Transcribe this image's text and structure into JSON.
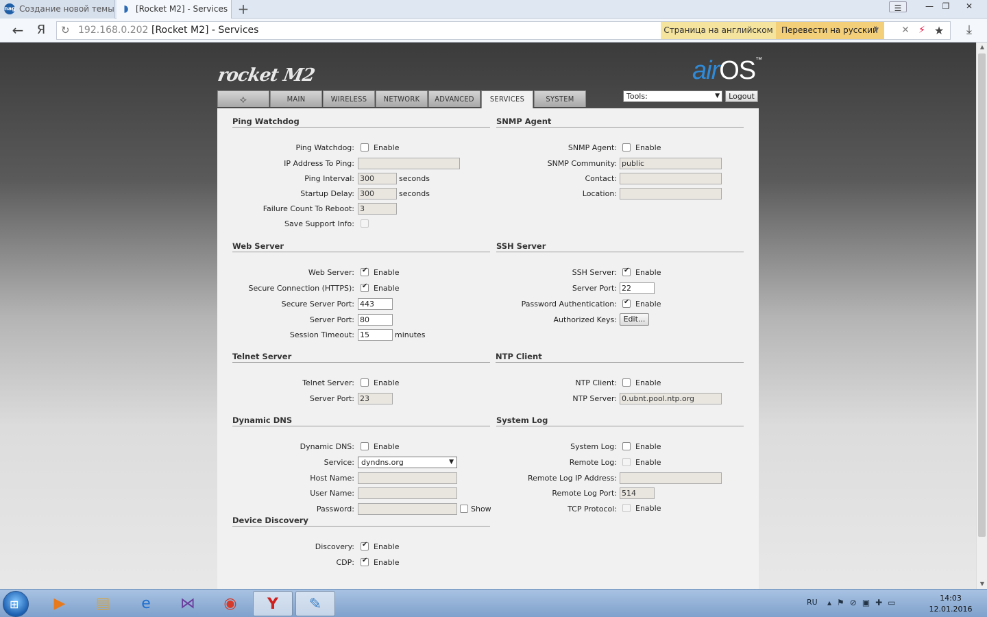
{
  "browser": {
    "tabs": [
      {
        "label": "Создание новой темы",
        "favicon": "nag"
      },
      {
        "label": "[Rocket M2] - Services",
        "favicon": "rss"
      }
    ],
    "new_tab": "+",
    "url_host": "192.168.0.202",
    "url_title": "[Rocket M2] - Services",
    "translate_label": "Страница на английском",
    "translate_button": "Перевести на русский"
  },
  "header": {
    "brand": "rocket M2",
    "os_logo": "air",
    "os_logo_suffix": "OS",
    "tools_label": "Tools:",
    "logout": "Logout"
  },
  "nav_tabs": [
    "MAIN",
    "WIRELESS",
    "NETWORK",
    "ADVANCED",
    "SERVICES",
    "SYSTEM"
  ],
  "common": {
    "enable": "Enable",
    "seconds": "seconds",
    "minutes": "minutes",
    "show": "Show",
    "edit": "Edit..."
  },
  "ping_watchdog": {
    "title": "Ping Watchdog",
    "enable_label": "Ping Watchdog:",
    "ip_label": "IP Address To Ping:",
    "ip_value": "",
    "interval_label": "Ping Interval:",
    "interval_value": "300",
    "delay_label": "Startup Delay:",
    "delay_value": "300",
    "failure_label": "Failure Count To Reboot:",
    "failure_value": "3",
    "support_label": "Save Support Info:"
  },
  "snmp": {
    "title": "SNMP Agent",
    "enable_label": "SNMP Agent:",
    "community_label": "SNMP Community:",
    "community_value": "public",
    "contact_label": "Contact:",
    "contact_value": "",
    "location_label": "Location:",
    "location_value": ""
  },
  "web_server": {
    "title": "Web Server",
    "enable_label": "Web Server:",
    "https_label": "Secure Connection (HTTPS):",
    "secure_port_label": "Secure Server Port:",
    "secure_port_value": "443",
    "port_label": "Server Port:",
    "port_value": "80",
    "timeout_label": "Session Timeout:",
    "timeout_value": "15"
  },
  "ssh_server": {
    "title": "SSH Server",
    "enable_label": "SSH Server:",
    "port_label": "Server Port:",
    "port_value": "22",
    "password_label": "Password Authentication:",
    "keys_label": "Authorized Keys:"
  },
  "telnet": {
    "title": "Telnet Server",
    "enable_label": "Telnet Server:",
    "port_label": "Server Port:",
    "port_value": "23"
  },
  "ntp": {
    "title": "NTP Client",
    "enable_label": "NTP Client:",
    "server_label": "NTP Server:",
    "server_value": "0.ubnt.pool.ntp.org"
  },
  "ddns": {
    "title": "Dynamic DNS",
    "enable_label": "Dynamic DNS:",
    "service_label": "Service:",
    "service_value": "dyndns.org",
    "host_label": "Host Name:",
    "user_label": "User Name:",
    "password_label": "Password:"
  },
  "syslog": {
    "title": "System Log",
    "enable_label": "System Log:",
    "remote_label": "Remote Log:",
    "remote_ip_label": "Remote Log IP Address:",
    "remote_port_label": "Remote Log Port:",
    "remote_port_value": "514",
    "tcp_label": "TCP Protocol:"
  },
  "discovery": {
    "title": "Device Discovery",
    "enable_label": "Discovery:",
    "cdp_label": "CDP:"
  },
  "taskbar": {
    "lang": "RU",
    "time": "14:03",
    "date": "12.01.2016"
  }
}
